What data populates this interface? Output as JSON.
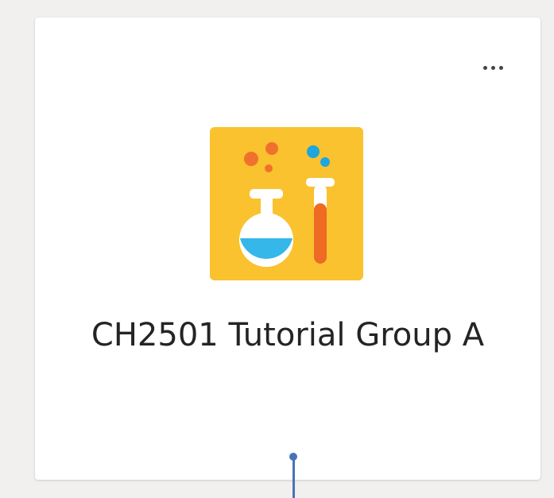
{
  "team_card": {
    "name": "CH2501 Tutorial Group A",
    "more_options_icon": "more-horizontal-icon",
    "avatar_icon": "chemistry-flask-test-tube-icon"
  },
  "colors": {
    "avatar_background": "#F9C22E",
    "bubble_orange": "#F0712C",
    "bubble_blue": "#1EA6DE",
    "flask_liquid": "#35B7EA",
    "tube_liquid": "#EF6A24",
    "glass": "#FFFFFF",
    "connector": "#4A72B8"
  }
}
